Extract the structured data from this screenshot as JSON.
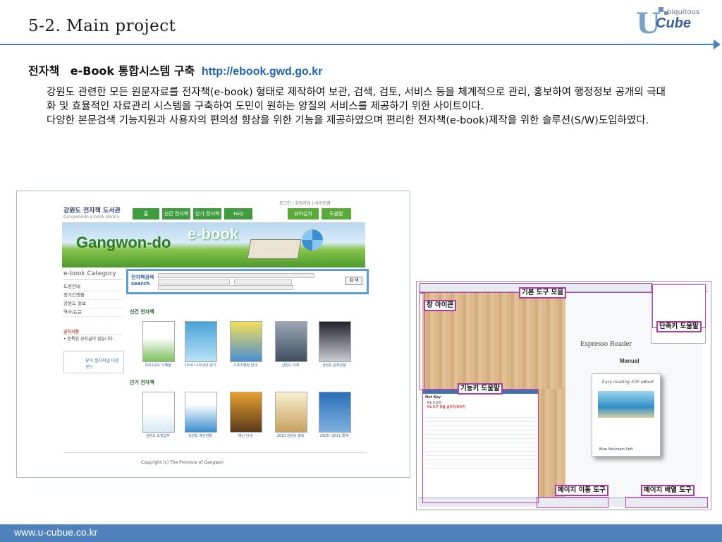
{
  "slide": {
    "title": "5-2. Main project",
    "heading_korean": "전자책",
    "heading_main": "e-Book 통합시스템 구축",
    "heading_url": "http://ebook.gwd.go.kr",
    "paragraph1": "강원도 관련한 모든 원문자료를 전자책(e-book) 형태로 제작하여 보관, 검색, 검토, 서비스 등을 체계적으로 관리, 홍보하여 행정정보 공개의 극대화 및 효율적인 자료관리 시스템을 구축하여 도민이 원하는 양질의 서비스를 제공하기 위한 사이트이다.",
    "paragraph2": "다양한 본문검색 기능지원과 사용자의 편의성 향상을 위한 기능을 제공하였으며 편리한 전자책(e-book)제작을 위한 솔루션(S/W)도입하였다.",
    "footer": "www.u-cubue.co.kr"
  },
  "logo": {
    "top_text": "biquitous",
    "letter": "U",
    "word": "Cube"
  },
  "website": {
    "site_name": "강원도 전자책 도서관",
    "site_sub": "Gangwondo e-book library",
    "top_links": "로그인 | 회원가입 | 사이트맵",
    "nav": [
      "홈",
      "신간 전자책",
      "인기 전자책",
      "FAQ",
      "뷰어설치",
      "도움말"
    ],
    "banner_title": "Gangwon-do",
    "banner_title2": "e-book",
    "category_title": "e-book Category",
    "categories": [
      "도정안내",
      "정기간행물",
      "강원도 홍보",
      "역사/논문"
    ],
    "search_label1": "전자책검색",
    "search_label2": "search",
    "search_button": "검 색",
    "notice_title": "공지사항",
    "notice_item": "• 등록된 공지글이 없습니다.",
    "viewer_button": "뷰어 설치파일 다운로드",
    "section_new": "신간 전자책",
    "section_popular": "인기 전자책",
    "new_books": [
      "2011년도 스페셜",
      "2010~2014년 중기",
      "스포츠행정 안내",
      "강원도 사회",
      "강원도 문화관광"
    ],
    "popular_books": [
      "강원도 도정업무",
      "강원도 예산현황",
      "예산 안내",
      "2010 강원도 홍보",
      "2005~2011 통계"
    ],
    "footer_text": "Copyright (c) The Province of Gangwon"
  },
  "viewer": {
    "labels": {
      "basic_tools": "기본 도구 모음",
      "window_icon": "창 아이콘",
      "shortcut_help": "단축키 도움말",
      "function_help": "기능키 도움말",
      "page_move": "페이지 이동 도구",
      "page_layout": "페이지 배열 도구"
    },
    "cover_title": "Espresso Reader",
    "cover_subtitle": "Manual",
    "box_text": "Easy reading XDF eBook",
    "help_title": "Hot Key",
    "help_key1": "F1",
    "help_key2": "F2",
    "help_text1": "도움말",
    "help_text2": "도구 모음 숨기기/보이기",
    "publisher": "Blue Mountain Soft"
  },
  "colors": {
    "accent": "#4f81bd",
    "label_border": "#b03aa8",
    "link": "#1f63b7"
  }
}
